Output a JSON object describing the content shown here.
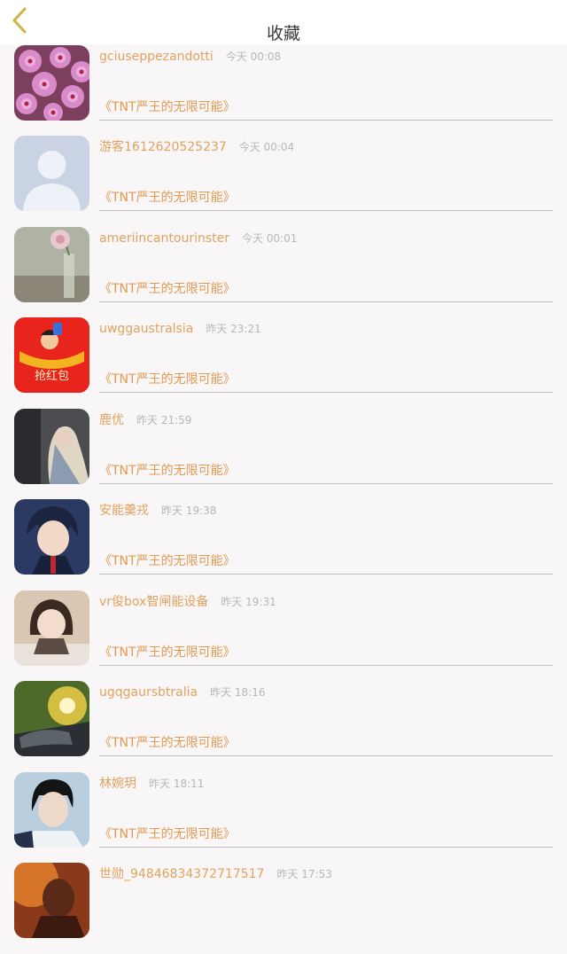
{
  "header": {
    "title": "收藏"
  },
  "favorites": [
    {
      "user": "gciuseppezandotti",
      "time": "今天 00:08",
      "novel": "《TNT严王的无限可能》",
      "avatar": "flowers"
    },
    {
      "user": "游客1612620525237",
      "time": "今天 00:04",
      "novel": "《TNT严王的无限可能》",
      "avatar": "default-silhouette"
    },
    {
      "user": "ameriincantourinster",
      "time": "今天 00:01",
      "novel": "《TNT严王的无限可能》",
      "avatar": "flower-vase"
    },
    {
      "user": "uwggaustralsia",
      "time": "昨天 23:21",
      "novel": "《TNT严王的无限可能》",
      "avatar": "red-envelope",
      "avatar_text": "抢红包"
    },
    {
      "user": "鹿优",
      "time": "昨天 21:59",
      "novel": "《TNT严王的无限可能》",
      "avatar": "blonde-girl"
    },
    {
      "user": "安能羹戎",
      "time": "昨天 19:38",
      "novel": "《TNT严王的无限可能》",
      "avatar": "anime-boy"
    },
    {
      "user": "vr俊box智闸能设备",
      "time": "昨天 19:31",
      "novel": "《TNT严王的无限可能》",
      "avatar": "child-photo"
    },
    {
      "user": "ugqgaursbtralia",
      "time": "昨天 18:16",
      "novel": "《TNT严王的无限可能》",
      "avatar": "car-sunset"
    },
    {
      "user": "林婉玥",
      "time": "昨天 18:11",
      "novel": "《TNT严王的无限可能》",
      "avatar": "young-man"
    },
    {
      "user": "世勋_94846834372717517",
      "time": "昨天 17:53",
      "novel": "",
      "avatar": "orange-portrait"
    }
  ],
  "colors": {
    "accent": "#e29a51",
    "back_icon": "#d4b240",
    "divider": "#bfbfbf"
  }
}
